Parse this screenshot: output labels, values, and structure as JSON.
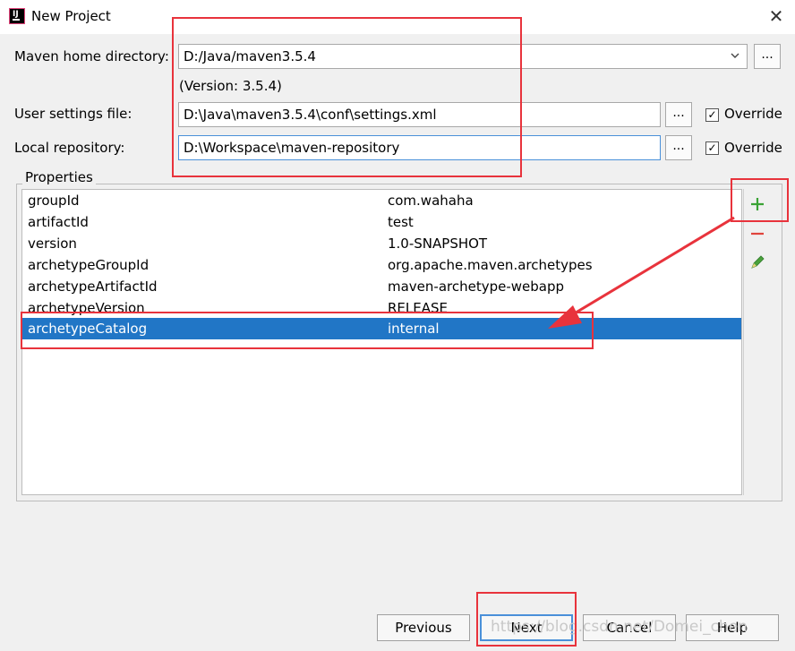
{
  "window": {
    "title": "New Project",
    "close_glyph": "✕"
  },
  "form": {
    "maven_home_label": "Maven home directory:",
    "maven_home_value": "D:/Java/maven3.5.4",
    "maven_version": "(Version: 3.5.4)",
    "user_settings_label": "User settings file:",
    "user_settings_value": "D:\\Java\\maven3.5.4\\conf\\settings.xml",
    "local_repo_label": "Local repository:",
    "local_repo_value": "D:\\Workspace\\maven-repository",
    "browse_label": "...",
    "override_label": "Override",
    "override_settings_checked": true,
    "override_repo_checked": true
  },
  "properties": {
    "title": "Properties",
    "rows": [
      {
        "key": "groupId",
        "value": "com.wahaha"
      },
      {
        "key": "artifactId",
        "value": "test"
      },
      {
        "key": "version",
        "value": "1.0-SNAPSHOT"
      },
      {
        "key": "archetypeGroupId",
        "value": "org.apache.maven.archetypes"
      },
      {
        "key": "archetypeArtifactId",
        "value": "maven-archetype-webapp"
      },
      {
        "key": "archetypeVersion",
        "value": "RELEASE"
      },
      {
        "key": "archetypeCatalog",
        "value": "internal",
        "selected": true
      }
    ],
    "tools": {
      "add": "+",
      "remove": "−",
      "edit_icon": "pencil-icon"
    }
  },
  "buttons": {
    "previous": "Previous",
    "next": "Next",
    "cancel": "Cancel",
    "help": "Help"
  },
  "watermark": "https://blog.csdn.net/Domei_chen",
  "colors": {
    "selection": "#2176c6",
    "annotation_red": "#e8333c",
    "add_green": "#3aa335",
    "remove_red": "#e0443c",
    "focus_blue": "#4a90d9"
  }
}
